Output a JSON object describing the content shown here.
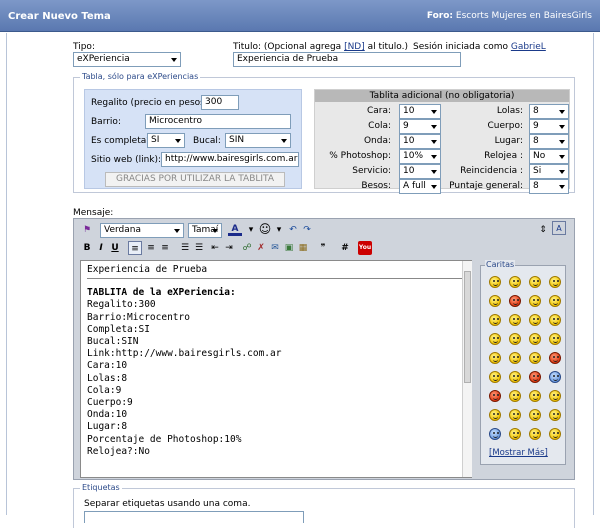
{
  "header": {
    "title": "Crear Nuevo Tema",
    "forum_label": "Foro:",
    "forum_name": "Escorts Mujeres en BairesGirls"
  },
  "form": {
    "tipo_label": "Tipo:",
    "tipo_value": "eXPeriencia",
    "titulo_label_pre": "Titulo: (Opcional agrega ",
    "titulo_link": "[ND]",
    "titulo_label_post": " al titulo.)",
    "titulo_value": "Experiencia de Prueba",
    "session_label": "Sesión iniciada como ",
    "session_user": "GabrieL"
  },
  "tabla": {
    "legend": "Tabla, sólo para eXPeriencias",
    "regalito_label": "Regalito (precio en pesos):",
    "regalito_value": "300",
    "barrio_label": "Barrio:",
    "barrio_value": "Microcentro",
    "completa_label": "Es completa?:",
    "completa_value": "SI",
    "bucal_label": "Bucal:",
    "bucal_value": "SIN",
    "sitio_label": "Sitio web (link):",
    "sitio_value": "http://www.bairesgirls.com.ar",
    "thanks_button": "GRACIAS POR UTILIZAR LA TABLITA"
  },
  "tablita": {
    "title": "Tablita adicional (no obligatoria)",
    "left": [
      {
        "label": "Cara:",
        "value": "10"
      },
      {
        "label": "Cola:",
        "value": "9"
      },
      {
        "label": "Onda:",
        "value": "10"
      },
      {
        "label": "% Photoshop:",
        "value": "10%"
      },
      {
        "label": "Servicio:",
        "value": "10"
      },
      {
        "label": "Besos:",
        "value": "A full"
      }
    ],
    "right": [
      {
        "label": "Lolas:",
        "value": "8"
      },
      {
        "label": "Cuerpo:",
        "value": "9"
      },
      {
        "label": "Lugar:",
        "value": "8"
      },
      {
        "label": "Relojea :",
        "value": "No"
      },
      {
        "label": "Reincidencia :",
        "value": "Si"
      },
      {
        "label": "Puntaje general:",
        "value": "8"
      }
    ]
  },
  "mensaje": {
    "label": "Mensaje:",
    "font_value": "Verdana",
    "size_value": "Tamaí",
    "text_lines": [
      "Experiencia de Prueba",
      "",
      "TABLITA de la eXPeriencia:",
      "Regalito:300",
      "Barrio:Microcentro",
      "Completa:SI",
      "Bucal:SIN",
      "Link:http://www.bairesgirls.com.ar",
      "Cara:10",
      "Lolas:8",
      "Cola:9",
      "Cuerpo:9",
      "Onda:10",
      "Lugar:8",
      "Porcentaje de Photoshop:10%",
      "Relojea?:No"
    ]
  },
  "caritas": {
    "legend": "Caritas",
    "more_link": "[Mostrar Más]"
  },
  "etiquetas": {
    "legend": "Etiquetas",
    "help": "Separar etiquetas usando una coma."
  },
  "toolbar": {
    "bold": "B",
    "italic": "I",
    "underline": "U",
    "hash": "#",
    "youtube": "You"
  }
}
